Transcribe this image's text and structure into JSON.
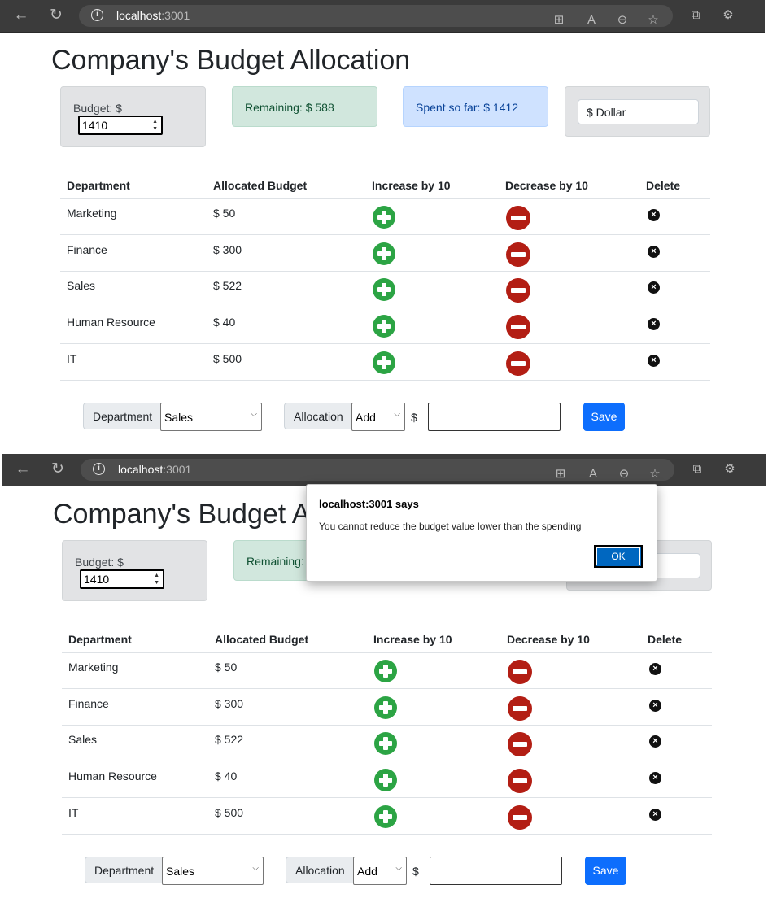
{
  "browser": {
    "host": "localhost",
    "port": ":3001"
  },
  "app": {
    "title": "Company's Budget Allocation",
    "budget_label": "Budget: $",
    "budget_value": "1410",
    "remaining": "Remaining: $ 588",
    "spent": "Spent so far: $ 1412",
    "currency": "$ Dollar",
    "columns": [
      "Department",
      "Allocated Budget",
      "Increase by 10",
      "Decrease by 10",
      "Delete"
    ],
    "rows": [
      {
        "name": "Marketing",
        "budget": "$ 50"
      },
      {
        "name": "Finance",
        "budget": "$ 300"
      },
      {
        "name": "Sales",
        "budget": "$ 522"
      },
      {
        "name": "Human Resource",
        "budget": "$ 40"
      },
      {
        "name": "IT",
        "budget": "$ 500"
      }
    ],
    "form": {
      "department_label": "Department",
      "department_value": "Sales",
      "allocation_label": "Allocation",
      "allocation_value": "Add",
      "currency_symbol": "$",
      "cost_value": "",
      "save_label": "Save"
    }
  },
  "dialog": {
    "title": "localhost:3001 says",
    "message": "You cannot reduce the budget value lower than the spending",
    "ok_label": "OK"
  },
  "colors": {
    "increase": "#2ca444",
    "decrease": "#b31e14",
    "save": "#0d6efd",
    "ok": "#0067c0"
  },
  "icons": [
    "back-arrow-icon",
    "reload-icon",
    "info-icon",
    "plus-circle-icon",
    "minus-circle-icon",
    "x-circle-icon"
  ]
}
